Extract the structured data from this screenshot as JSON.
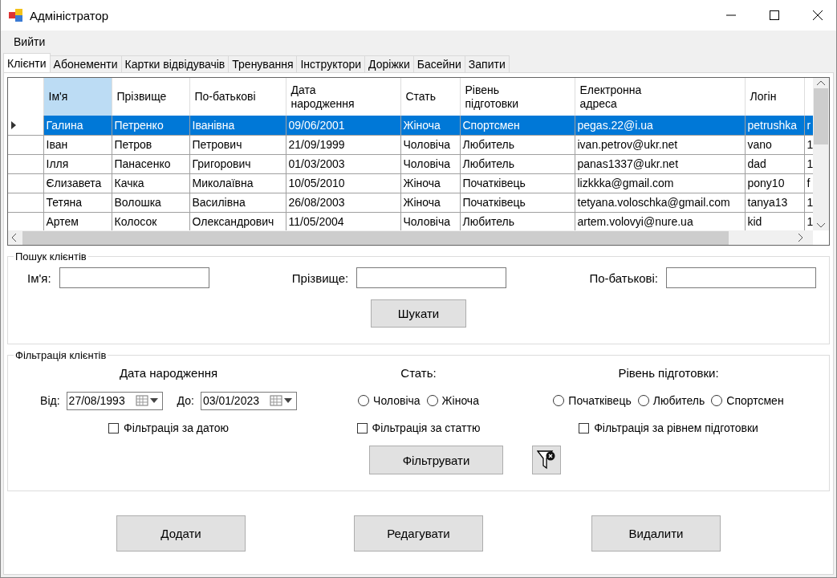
{
  "window": {
    "title": "Адміністратор"
  },
  "menu": [
    "Вийти"
  ],
  "tabs": [
    {
      "label": "Клієнти",
      "selected": true
    },
    {
      "label": "Абонементи",
      "selected": false
    },
    {
      "label": "Картки відвідувачів",
      "selected": false
    },
    {
      "label": "Тренування",
      "selected": false
    },
    {
      "label": "Інструктори",
      "selected": false
    },
    {
      "label": "Доріжки",
      "selected": false
    },
    {
      "label": "Басейни",
      "selected": false
    },
    {
      "label": "Запити",
      "selected": false
    }
  ],
  "table": {
    "columns": [
      {
        "label": "Ім'я",
        "selected": true
      },
      {
        "label": "Прізвище",
        "selected": false
      },
      {
        "label": "По-батькові",
        "selected": false
      },
      {
        "label": "Дата народження",
        "selected": false
      },
      {
        "label": "Стать",
        "selected": false
      },
      {
        "label": "Рівень підготовки",
        "selected": false
      },
      {
        "label": "Електронна адреса",
        "selected": false
      },
      {
        "label": "Логін",
        "selected": false
      },
      {
        "selected": false
      }
    ],
    "rows": [
      {
        "selected": true,
        "cells": [
          "Галина",
          "Петренко",
          "Іванівна",
          "09/06/2001",
          "Жіноча",
          "Спортсмен",
          "pegas.22@i.ua",
          "petrushka",
          "r"
        ]
      },
      {
        "selected": false,
        "cells": [
          "Іван",
          "Петров",
          "Петрович",
          "21/09/1999",
          "Чоловіча",
          "Любитель",
          "ivan.petrov@ukr.net",
          "vano",
          "1"
        ]
      },
      {
        "selected": false,
        "cells": [
          "Ілля",
          "Панасенко",
          "Григорович",
          "01/03/2003",
          "Чоловіча",
          "Любитель",
          "panas1337@ukr.net",
          "dad",
          "1"
        ]
      },
      {
        "selected": false,
        "cells": [
          "Єлизавета",
          "Качка",
          "Миколаївна",
          "10/05/2010",
          "Жіноча",
          "Початківець",
          "lizkkka@gmail.com",
          "pony10",
          "f"
        ]
      },
      {
        "selected": false,
        "cells": [
          "Тетяна",
          "Волошка",
          "Василівна",
          "26/08/2003",
          "Жіноча",
          "Початківець",
          "tetyana.voloschka@gmail.com",
          "tanya13",
          "1"
        ]
      },
      {
        "selected": false,
        "cells": [
          "Артем",
          "Колосок",
          "Олександрович",
          "11/05/2004",
          "Чоловіча",
          "Любитель",
          "artem.volovyi@nure.ua",
          "kid",
          "1"
        ]
      }
    ]
  },
  "search": {
    "title": "Пошук клієнтів",
    "fields": [
      {
        "label": "Ім'я:"
      },
      {
        "label": "Прізвище:"
      },
      {
        "label": "По-батькові:"
      }
    ],
    "button": "Шукати"
  },
  "filter": {
    "title": "Фільтрація клієнтів",
    "date": {
      "title": "Дата народження",
      "from_label": "Від:",
      "from_value": "27/08/1993",
      "to_label": "До:",
      "to_value": "03/01/2023",
      "checkbox": {
        "label": "Фільтрація за датою",
        "checked": false
      }
    },
    "gender": {
      "title": "Стать:",
      "options": [
        {
          "label": "Чоловіча",
          "selected": false
        },
        {
          "label": "Жіноча",
          "selected": false
        }
      ],
      "checkbox": {
        "label": "Фільтрація за статтю",
        "checked": false
      }
    },
    "level": {
      "title": "Рівень підготовки:",
      "options": [
        {
          "label": "Початківець",
          "selected": false
        },
        {
          "label": "Любитель",
          "selected": false
        },
        {
          "label": "Спортсмен",
          "selected": false
        }
      ],
      "checkbox": {
        "label": "Фільтрація за рівнем підготовки",
        "checked": false
      }
    },
    "button": "Фільтрувати"
  },
  "actions": [
    "Додати",
    "Редагувати",
    "Видалити"
  ]
}
